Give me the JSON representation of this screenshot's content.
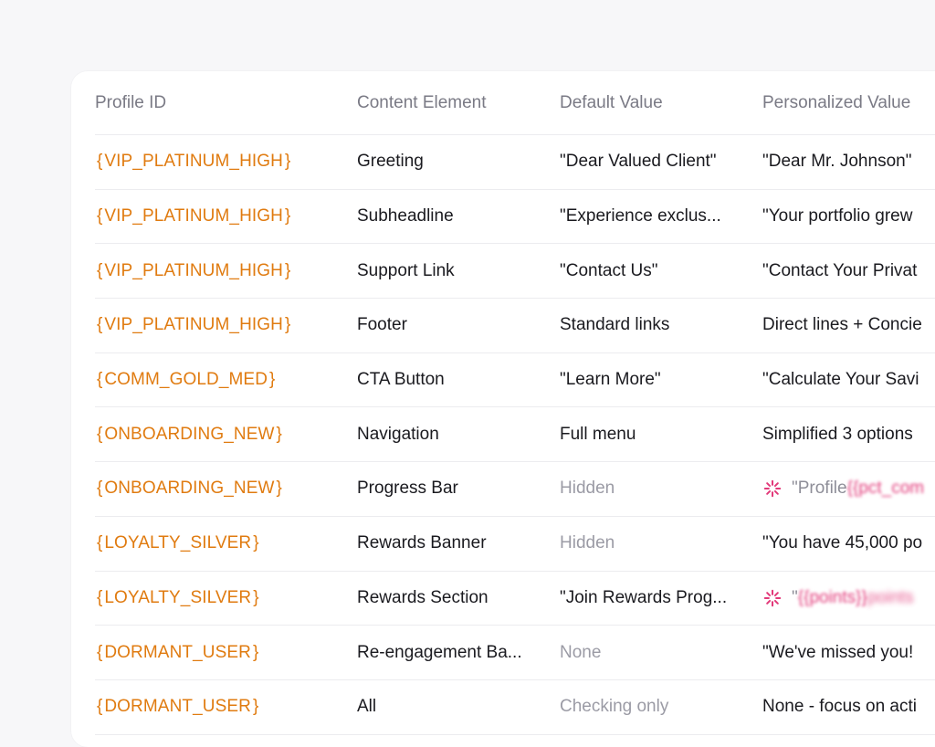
{
  "table": {
    "headers": [
      "Profile ID",
      "Content Element",
      "Default Value",
      "Personalized Value"
    ],
    "rows": [
      {
        "profile": "VIP_PLATINUM_HIGH",
        "element": "Greeting",
        "default": "\"Dear Valued Client\"",
        "personalized": "\"Dear Mr. Johnson\""
      },
      {
        "profile": "VIP_PLATINUM_HIGH",
        "element": "Subheadline",
        "default": "\"Experience exclus...",
        "personalized": "\"Your portfolio grew"
      },
      {
        "profile": "VIP_PLATINUM_HIGH",
        "element": "Support Link",
        "default": "\"Contact Us\"",
        "personalized": "\"Contact Your Privat"
      },
      {
        "profile": "VIP_PLATINUM_HIGH",
        "element": "Footer",
        "default": "Standard links",
        "personalized": "Direct lines + Concie"
      },
      {
        "profile": "COMM_GOLD_MED",
        "element": "CTA Button",
        "default": "\"Learn More\"",
        "personalized": "\"Calculate Your Savi"
      },
      {
        "profile": "ONBOARDING_NEW",
        "element": "Navigation",
        "default": "Full menu",
        "personalized": "Simplified 3 options"
      },
      {
        "profile": "ONBOARDING_NEW",
        "element": "Progress Bar",
        "default": "Hidden",
        "personalized_prefix": "\"Profile ",
        "personalized_token": "{{pct_com",
        "pending": true
      },
      {
        "profile": "LOYALTY_SILVER",
        "element": "Rewards Banner",
        "default": "Hidden",
        "personalized": "\"You have 45,000 po"
      },
      {
        "profile": "LOYALTY_SILVER",
        "element": "Rewards Section",
        "default": "\"Join Rewards Prog...",
        "personalized_prefix": "\"",
        "personalized_token": "{{points}}",
        "personalized_tail": " points",
        "pending": true
      },
      {
        "profile": "DORMANT_USER",
        "element": "Re-engagement Ba...",
        "default": "None",
        "personalized": "\"We've missed you!"
      },
      {
        "profile": "DORMANT_USER",
        "element": "All",
        "default": "Checking only",
        "personalized": "None - focus on acti"
      }
    ]
  },
  "colors": {
    "profile_id": "#e07b10",
    "muted": "#9b9ba5",
    "token": "#e23a7a"
  },
  "icons": {
    "pending": "loading-spinner-icon"
  }
}
